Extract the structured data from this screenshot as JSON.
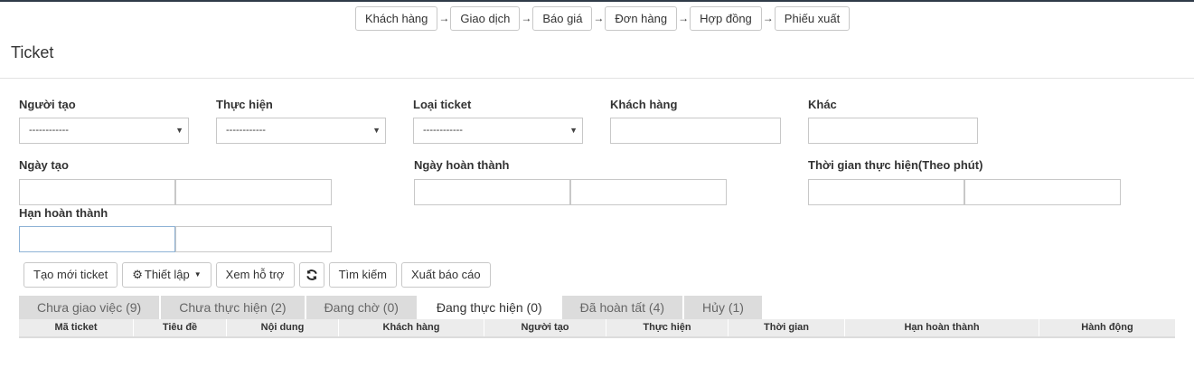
{
  "workflow": {
    "steps": [
      "Khách hàng",
      "Giao dịch",
      "Báo giá",
      "Đơn hàng",
      "Hợp đồng",
      "Phiếu xuất"
    ],
    "arrow": "→"
  },
  "page": {
    "title": "Ticket"
  },
  "filters": {
    "creator": {
      "label": "Người tạo",
      "value": "------------"
    },
    "assignee": {
      "label": "Thực hiện",
      "value": "------------"
    },
    "ticket_type": {
      "label": "Loại ticket",
      "value": "------------"
    },
    "customer": {
      "label": "Khách hàng",
      "value": ""
    },
    "other": {
      "label": "Khác",
      "value": ""
    },
    "created_date": {
      "label": "Ngày tạo",
      "from": "",
      "to": ""
    },
    "completed_date": {
      "label": "Ngày hoàn thành",
      "from": "",
      "to": ""
    },
    "duration": {
      "label": "Thời gian thực hiện(Theo phút)",
      "from": "",
      "to": ""
    },
    "deadline": {
      "label": "Hạn hoàn thành",
      "from": "",
      "to": ""
    }
  },
  "toolbar": {
    "new_ticket": "Tạo mới ticket",
    "settings": "Thiết lập",
    "view_support": "Xem hỗ trợ",
    "refresh_icon": "refresh-icon",
    "search": "Tìm kiếm",
    "export": "Xuất báo cáo"
  },
  "tabs": [
    {
      "label": "Chưa giao việc (9)",
      "active": false
    },
    {
      "label": "Chưa thực hiện (2)",
      "active": false
    },
    {
      "label": "Đang chờ (0)",
      "active": false
    },
    {
      "label": "Đang thực hiện (0)",
      "active": true
    },
    {
      "label": "Đã hoàn tất (4)",
      "active": false
    },
    {
      "label": "Hủy (1)",
      "active": false
    }
  ],
  "table": {
    "columns": [
      "Mã ticket",
      "Tiêu đề",
      "Nội dung",
      "Khách hàng",
      "Người tạo",
      "Thực hiện",
      "Thời gian",
      "Hạn hoàn thành",
      "Hành động"
    ]
  },
  "colors": {
    "tab_inactive": "#dcdcdc",
    "header_bg": "#ececec",
    "top_bar": "#2f3b48"
  }
}
